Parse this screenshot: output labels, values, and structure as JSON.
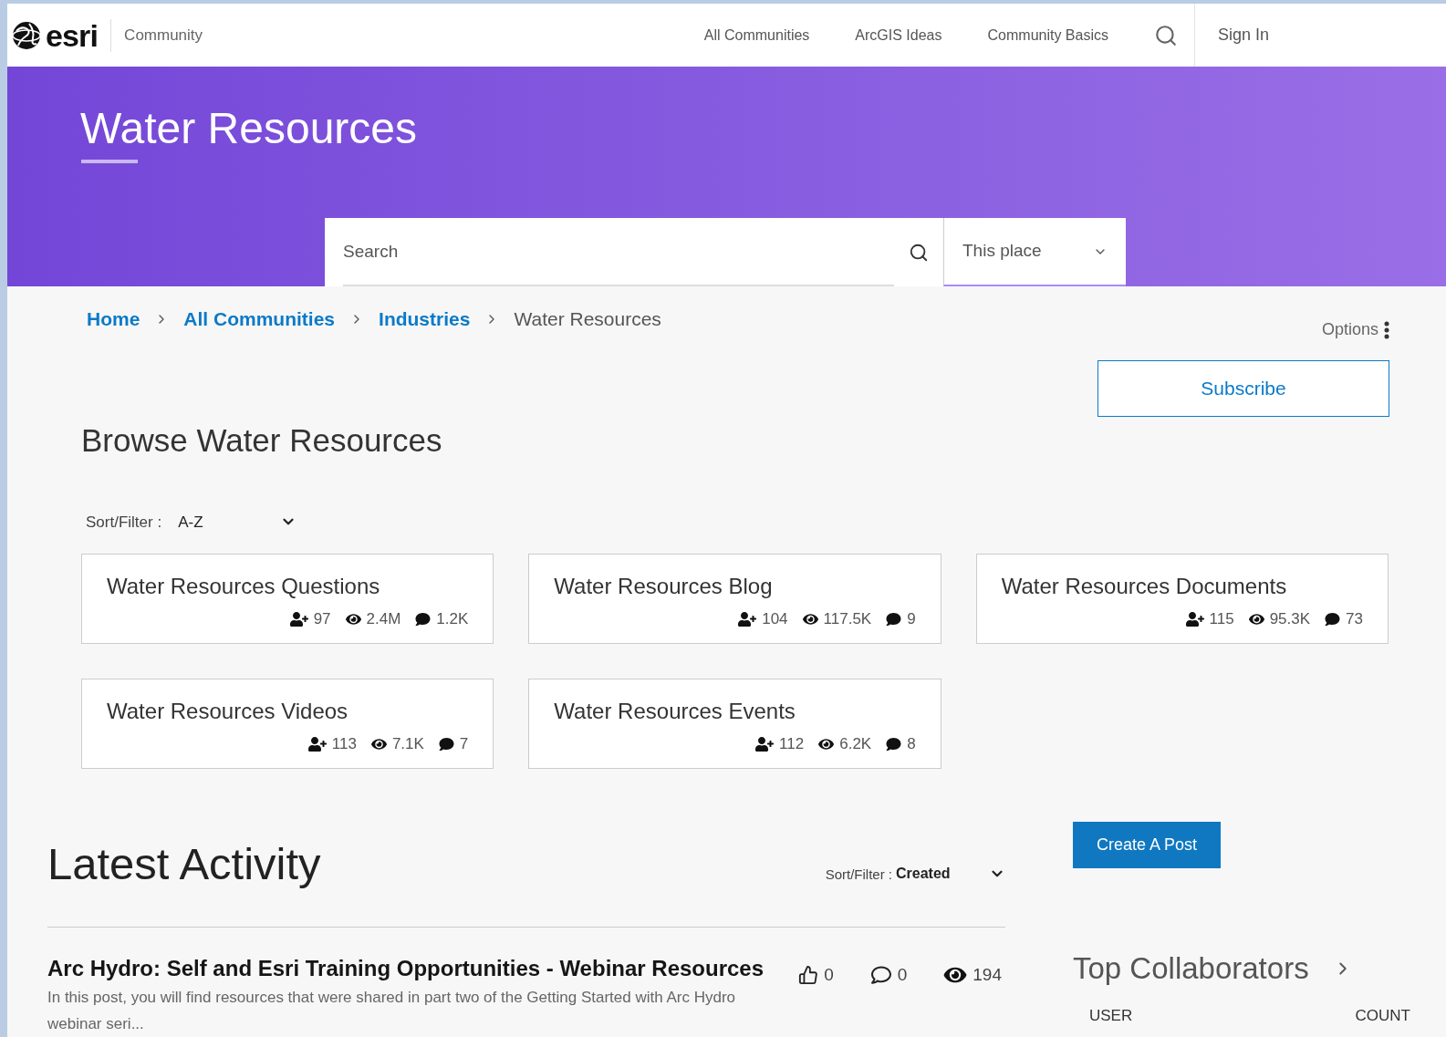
{
  "header": {
    "logo": "esri",
    "site": "Community",
    "nav": [
      "All Communities",
      "ArcGIS Ideas",
      "Community Basics"
    ],
    "sign_in": "Sign In"
  },
  "banner": {
    "title": "Water Resources",
    "search": {
      "placeholder": "Search",
      "scope": "This place"
    }
  },
  "breadcrumb": [
    {
      "label": "Home",
      "kind": "link"
    },
    {
      "label": "All Communities",
      "kind": "link"
    },
    {
      "label": "Industries",
      "kind": "link"
    },
    {
      "label": "Water Resources",
      "kind": "current"
    }
  ],
  "options": "Options",
  "subscribe": "Subscribe",
  "browse": {
    "title": "Browse Water Resources",
    "sort_label": "Sort/Filter :",
    "sort_value": "A-Z",
    "cards": [
      {
        "title": "Water Resources Questions",
        "members": "97",
        "views": "2.4M",
        "posts": "1.2K"
      },
      {
        "title": "Water Resources Blog",
        "members": "104",
        "views": "117.5K",
        "posts": "9"
      },
      {
        "title": "Water Resources Documents",
        "members": "115",
        "views": "95.3K",
        "posts": "73"
      },
      {
        "title": "Water Resources Videos",
        "members": "113",
        "views": "7.1K",
        "posts": "7"
      },
      {
        "title": "Water Resources Events",
        "members": "112",
        "views": "6.2K",
        "posts": "8"
      }
    ]
  },
  "latest": {
    "title": "Latest Activity",
    "sort_label": "Sort/Filter :",
    "sort_value": "Created",
    "posts": [
      {
        "title": "Arc Hydro: Self and Esri Training Opportunities - Webinar Resources",
        "excerpt": "In this post, you will find resources that were shared in part two of the Getting Started with Arc Hydro webinar seri...",
        "likes": "0",
        "replies": "0",
        "views": "194"
      }
    ]
  },
  "create_post": "Create A Post",
  "top_collaborators": {
    "title": "Top Collaborators",
    "columns": [
      "USER",
      "COUNT"
    ]
  }
}
